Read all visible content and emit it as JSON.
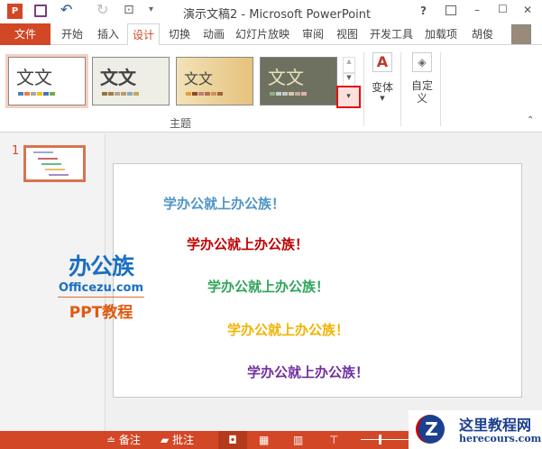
{
  "window": {
    "title": "演示文稿2 - Microsoft PowerPoint",
    "help": "?",
    "min": "–",
    "max": "☐",
    "close": "✕"
  },
  "tabs": [
    {
      "label": "文件"
    },
    {
      "label": "开始"
    },
    {
      "label": "插入"
    },
    {
      "label": "设计"
    },
    {
      "label": "切换"
    },
    {
      "label": "动画"
    },
    {
      "label": "幻灯片放映"
    },
    {
      "label": "审阅"
    },
    {
      "label": "视图"
    },
    {
      "label": "开发工具"
    },
    {
      "label": "加载项"
    }
  ],
  "user": {
    "name": "胡俊"
  },
  "ribbon": {
    "themes": [
      {
        "sample": "文文"
      },
      {
        "sample": "文文"
      },
      {
        "sample": "文文"
      },
      {
        "sample": "文文"
      }
    ],
    "group_label": "主题",
    "variants": "变体",
    "customize": "自定义"
  },
  "thumbnail": {
    "number": "1"
  },
  "slide": {
    "lines": [
      "学办公就上办公族！",
      "学办公就上办公族！",
      "学办公就上办公族！",
      "学办公就上办公族！",
      "学办公就上办公族！"
    ],
    "colors": [
      "#4f94c8",
      "#c00000",
      "#2ea55a",
      "#f0b400",
      "#7030a0"
    ]
  },
  "logo": {
    "cn": "办公族",
    "url": "Officezu.com",
    "sub": "PPT教程"
  },
  "status": {
    "notes": "备注",
    "comments": "批注"
  },
  "watermark": {
    "cn": "这里教程网",
    "url": "herecours.com"
  }
}
